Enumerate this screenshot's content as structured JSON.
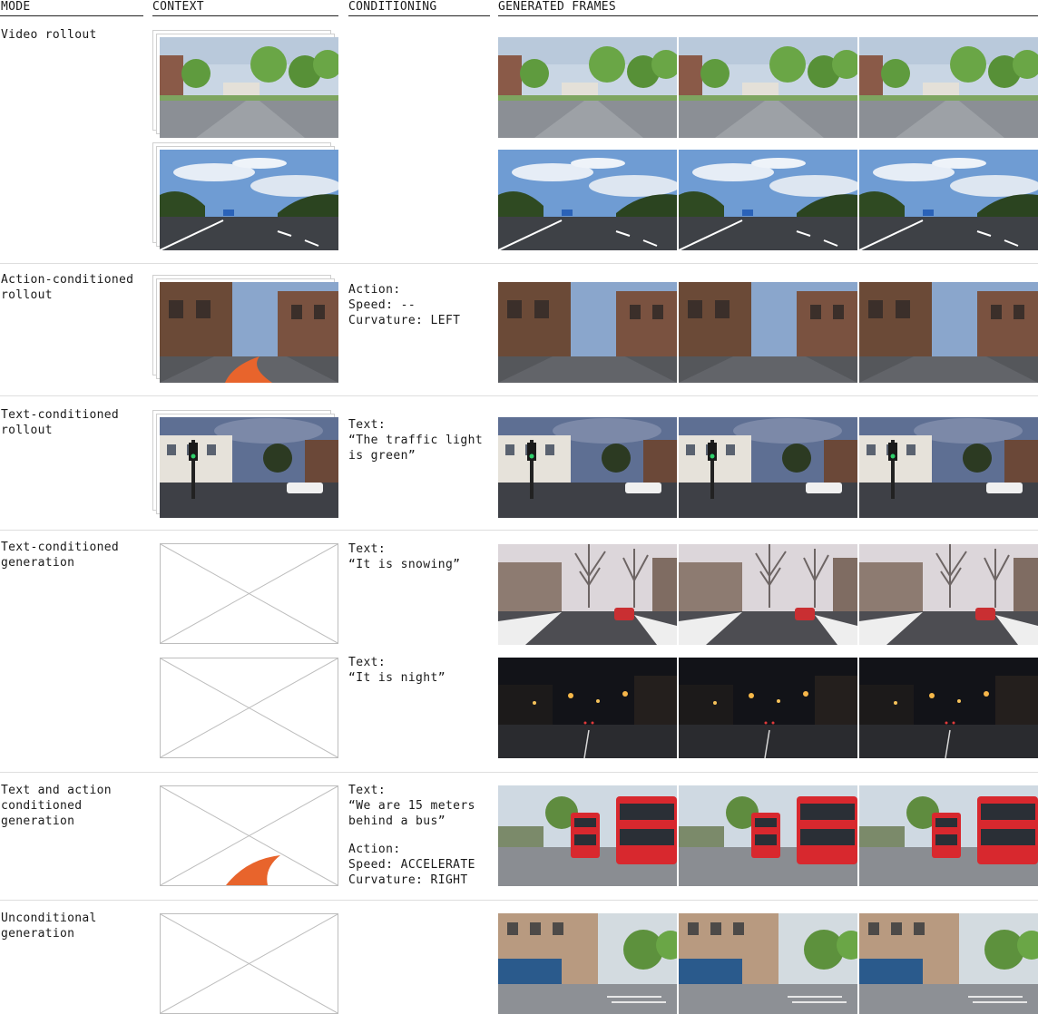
{
  "headers": {
    "mode": "MODE",
    "context": "CONTEXT",
    "conditioning": "CONDITIONING",
    "generated": "GENERATED FRAMES"
  },
  "rows": [
    {
      "mode": "Video rollout",
      "conditioning": []
    },
    {
      "mode": "Action-conditioned\nrollout",
      "conditioning": [
        "Action:\nSpeed: --\nCurvature: LEFT"
      ]
    },
    {
      "mode": "Text-conditioned\nrollout",
      "conditioning": [
        "Text:\n“The traffic light\nis green”"
      ]
    },
    {
      "mode": "Text-conditioned\ngeneration",
      "conditioning": [
        "Text:\n“It is snowing”",
        "Text:\n“It is night”"
      ]
    },
    {
      "mode": "Text and action\nconditioned\ngeneration",
      "conditioning": [
        "Text:\n“We are 15 meters\nbehind a bus”",
        "Action:\nSpeed: ACCELERATE\nCurvature: RIGHT"
      ]
    },
    {
      "mode": "Unconditional\ngeneration",
      "conditioning": []
    }
  ],
  "colors": {
    "trajectory": "#e8642c",
    "bus": "#d8282e",
    "sky_day": "#c9d6e4",
    "sky_blue": "#6f9cd3",
    "sky_dusk": "#5e6f93",
    "sky_snow": "#dcd6da",
    "night": "#121318",
    "tree": "#5f9b3e",
    "road": "#5c5f64",
    "brick": "#6b4a37"
  },
  "icons": {
    "trajectory": "orange-curve-trajectory",
    "empty_context": "crossed-placeholder-box"
  }
}
